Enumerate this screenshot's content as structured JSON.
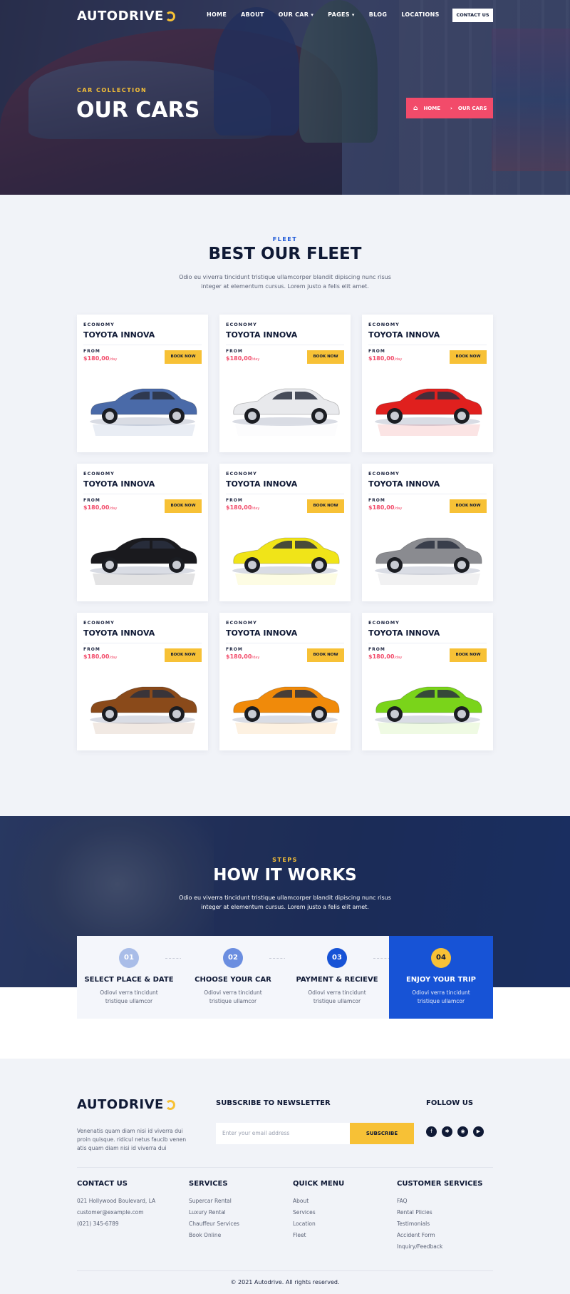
{
  "header": {
    "logo_text": "AUTODRIVE",
    "nav": [
      "HOME",
      "ABOUT",
      "OUR CAR",
      "PAGES",
      "BLOG",
      "LOCATIONS"
    ],
    "contact_button": "CONTACT US"
  },
  "hero": {
    "eyebrow": "CAR COLLECTION",
    "title": "OUR CARS",
    "breadcrumb_home": "HOME",
    "breadcrumb_current": "OUR CARS"
  },
  "fleet": {
    "eyebrow": "FLEET",
    "title": "BEST OUR FLEET",
    "desc_line1": "Odio eu viverra tincidunt tristique ullamcorper blandit dipiscing nunc risus",
    "desc_line2": "integer at elementum cursus. Lorem justo a felis elit amet.",
    "cards": [
      {
        "category": "ECONOMY",
        "name": "TOYOTA INNOVA",
        "from": "FROM",
        "price": "$180,00",
        "per": "/day",
        "book": "BOOK NOW",
        "color": "#4a6aa8"
      },
      {
        "category": "ECONOMY",
        "name": "TOYOTA INNOVA",
        "from": "FROM",
        "price": "$180,00",
        "per": "/day",
        "book": "BOOK NOW",
        "color": "#e8e9ec"
      },
      {
        "category": "ECONOMY",
        "name": "TOYOTA INNOVA",
        "from": "FROM",
        "price": "$180,00",
        "per": "/day",
        "book": "BOOK NOW",
        "color": "#e0201e"
      },
      {
        "category": "ECONOMY",
        "name": "TOYOTA INNOVA",
        "from": "FROM",
        "price": "$180,00",
        "per": "/day",
        "book": "BOOK NOW",
        "color": "#1a1a1e"
      },
      {
        "category": "ECONOMY",
        "name": "TOYOTA INNOVA",
        "from": "FROM",
        "price": "$180,00",
        "per": "/day",
        "book": "BOOK NOW",
        "color": "#f0e418"
      },
      {
        "category": "ECONOMY",
        "name": "TOYOTA INNOVA",
        "from": "FROM",
        "price": "$180,00",
        "per": "/day",
        "book": "BOOK NOW",
        "color": "#8a8b90"
      },
      {
        "category": "ECONOMY",
        "name": "TOYOTA INNOVA",
        "from": "FROM",
        "price": "$180,00",
        "per": "/day",
        "book": "BOOK NOW",
        "color": "#8a4a1a"
      },
      {
        "category": "ECONOMY",
        "name": "TOYOTA INNOVA",
        "from": "FROM",
        "price": "$180,00",
        "per": "/day",
        "book": "BOOK NOW",
        "color": "#f08a0a"
      },
      {
        "category": "ECONOMY",
        "name": "TOYOTA INNOVA",
        "from": "FROM",
        "price": "$180,00",
        "per": "/day",
        "book": "BOOK NOW",
        "color": "#7ad41a"
      }
    ]
  },
  "how": {
    "eyebrow": "STEPS",
    "title": "HOW IT WORKS",
    "desc_line1": "Odio eu viverra tincidunt tristique ullamcorper blandit dipiscing nunc risus",
    "desc_line2": "integer at elementum cursus. Lorem justo a felis elit amet.",
    "steps": [
      {
        "num": "01",
        "title": "SELECT PLACE & DATE",
        "desc1": "Odiovi verra tincidunt",
        "desc2": "tristique ullamcor",
        "color": "#a9bde8"
      },
      {
        "num": "02",
        "title": "CHOOSE YOUR CAR",
        "desc1": "Odiovi verra tincidunt",
        "desc2": "tristique ullamcor",
        "color": "#6b8ee0"
      },
      {
        "num": "03",
        "title": "PAYMENT & RECIEVE",
        "desc1": "Odiovi verra tincidunt",
        "desc2": "tristique ullamcor",
        "color": "#1753d6"
      },
      {
        "num": "04",
        "title": "ENJOY YOUR TRIP",
        "desc1": "Odiovi verra tincidunt",
        "desc2": "tristique ullamcor",
        "color": "#f7c136"
      }
    ]
  },
  "footer": {
    "logo_text": "AUTODRIVE",
    "about_line1": "Venenatis quam diam nisi id viverra dui",
    "about_line2": "proin quisque. ridicul netus faucib venen",
    "about_line3": "atis quam diam nisi id viverra dui",
    "newsletter_title": "SUBSCRIBE TO NEWSLETTER",
    "email_placeholder": "Enter your email address",
    "subscribe_label": "SUBSCRIBE",
    "follow_title": "FOLLOW US",
    "social_icons": [
      "facebook-icon",
      "twitter-icon",
      "instagram-icon",
      "youtube-icon"
    ],
    "contact": {
      "title": "CONTACT US",
      "items": [
        "021 Hollywood Boulevard, LA",
        "customer@example.com",
        "(021) 345-6789"
      ]
    },
    "services": {
      "title": "SERVICES",
      "items": [
        "Supercar Rental",
        "Luxury Rental",
        "Chauffeur Services",
        "Book Online"
      ]
    },
    "quick": {
      "title": "QUICK MENU",
      "items": [
        "About",
        "Services",
        "Location",
        "Fleet"
      ]
    },
    "customer": {
      "title": "CUSTOMER SERVICES",
      "items": [
        "FAQ",
        "Rental Plicies",
        "Testimonials",
        "Accident Form",
        "Inquiry/Feedback"
      ]
    },
    "copyright": "© 2021 Autodrive. All rights reserved."
  },
  "colors": {
    "accent": "#f7c136",
    "pink": "#f24b6a",
    "blue": "#1753d6",
    "navy": "#0f1935"
  }
}
